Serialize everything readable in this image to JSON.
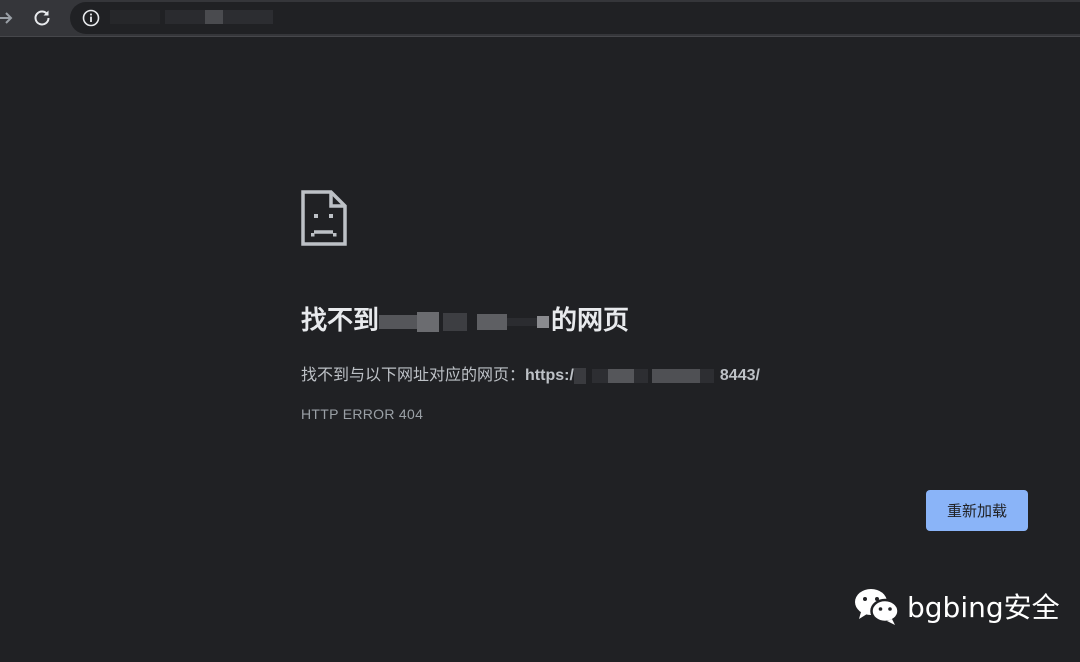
{
  "browser": {
    "back_icon": "arrow-forward-icon",
    "reload_icon": "reload-icon",
    "info_icon": "info-icon"
  },
  "page": {
    "sad_icon": "sad-page-icon",
    "headline_prefix": "找不到",
    "headline_suffix": "的网页",
    "desc_prefix": "找不到与以下网址对应的网页：",
    "url_prefix": "https:/",
    "url_suffix": "8443/",
    "error_code": "HTTP ERROR 404",
    "reload_label": "重新加载"
  },
  "watermark": {
    "icon": "wechat-icon",
    "text": "bgbing安全"
  },
  "colors": {
    "background": "#202124",
    "button": "#8ab4f8",
    "text": "#e8eaed"
  }
}
